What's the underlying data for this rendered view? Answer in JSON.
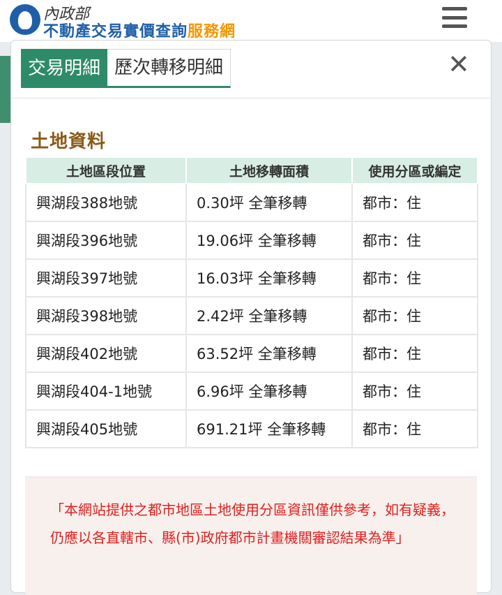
{
  "header": {
    "ministry": "內政部",
    "title_main": "不動產交易實價查詢",
    "title_accent": "服務網"
  },
  "modal": {
    "tabs": [
      {
        "label": "交易明細",
        "active": true
      },
      {
        "label": "歷次轉移明細",
        "active": false
      }
    ],
    "close_label": "✕",
    "section_title": "土地資料",
    "table": {
      "headers": [
        "土地區段位置",
        "土地移轉面積",
        "使用分區或編定"
      ],
      "rows": [
        [
          "興湖段388地號",
          "0.30坪 全筆移轉",
          "都市：住"
        ],
        [
          "興湖段396地號",
          "19.06坪 全筆移轉",
          "都市：住"
        ],
        [
          "興湖段397地號",
          "16.03坪 全筆移轉",
          "都市：住"
        ],
        [
          "興湖段398地號",
          "2.42坪 全筆移轉",
          "都市：住"
        ],
        [
          "興湖段402地號",
          "63.52坪 全筆移轉",
          "都市：住"
        ],
        [
          "興湖段404-1地號",
          "6.96坪 全筆移轉",
          "都市：住"
        ],
        [
          "興湖段405地號",
          "691.21坪 全筆移轉",
          "都市：住"
        ]
      ]
    },
    "notice": "「本網站提供之都市地區土地使用分區資訊僅供參考，如有疑義，仍應以各直轄市、縣(市)政府都市計畫機關審認結果為準」"
  },
  "colors": {
    "accent_green": "#2e8b6a",
    "brand_blue": "#1f5fa8",
    "brand_orange": "#f39800",
    "section_title": "#8a5a14",
    "notice_red": "#e02020"
  },
  "icons": [
    "logo-icon",
    "hamburger-icon",
    "close-icon"
  ]
}
